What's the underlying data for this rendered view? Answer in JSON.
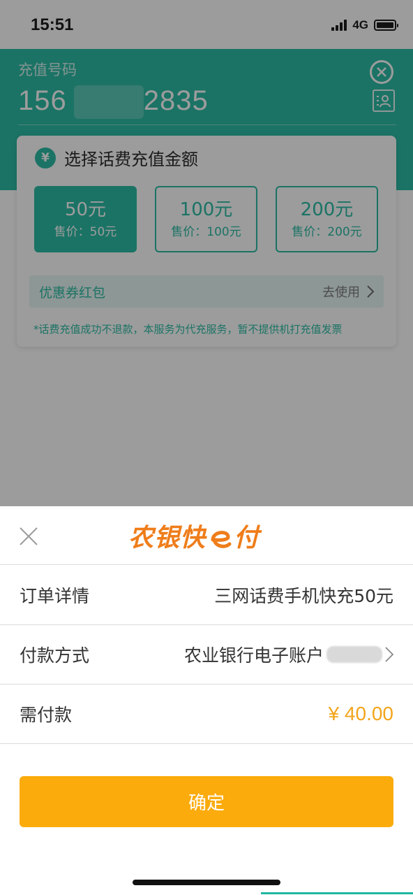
{
  "status_bar": {
    "time": "15:51",
    "network": "4G"
  },
  "recharge": {
    "label": "充值号码",
    "phone_prefix": "156",
    "phone_suffix": "2835"
  },
  "amount_card": {
    "title": "选择话费充值金额",
    "yen_symbol": "¥",
    "options": [
      {
        "amount": "50元",
        "price": "售价：50元",
        "selected": true
      },
      {
        "amount": "100元",
        "price": "售价：100元",
        "selected": false
      },
      {
        "amount": "200元",
        "price": "售价：200元",
        "selected": false
      }
    ],
    "coupon_label": "优惠券红包",
    "coupon_action": "去使用",
    "notice": "*话费充值成功不退款，本服务为代充服务，暂不提供机打充值发票"
  },
  "payment_sheet": {
    "brand": "农银快e付",
    "brand_parts": [
      "农银快",
      "付"
    ],
    "order_label": "订单详情",
    "order_value": "三网话费手机快充50元",
    "method_label": "付款方式",
    "method_value": "农业银行电子账户",
    "amount_label": "需付款",
    "amount_value": "¥ 40.00",
    "confirm_label": "确定"
  },
  "colors": {
    "teal": "#21b8a1",
    "orange": "#ef7d1a",
    "button": "#fbab0c",
    "price": "#f2a51c"
  }
}
